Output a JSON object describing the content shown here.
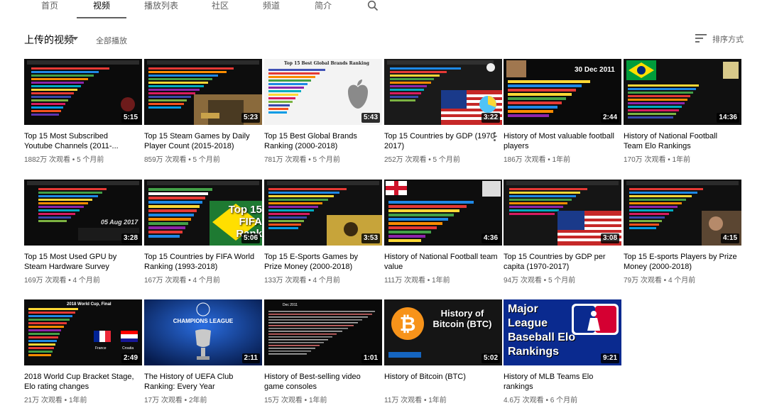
{
  "tabs": {
    "home": "首页",
    "videos": "视频",
    "playlists": "播放列表",
    "community": "社区",
    "channels": "频道",
    "about": "简介"
  },
  "section": {
    "title": "上传的视频",
    "play_all": "全部播放",
    "sort_label": "排序方式"
  },
  "videos": [
    {
      "title": "Top 15 Most Subscribed Youtube Channels (2011-...",
      "views": "1882万 次观看",
      "age": "5 个月前",
      "duration": "5:15"
    },
    {
      "title": "Top 15 Steam Games by Daily Player Count (2015-2018)",
      "views": "859万 次观看",
      "age": "5 个月前",
      "duration": "5:23"
    },
    {
      "title": "Top 15 Best Global Brands Ranking (2000-2018)",
      "views": "781万 次观看",
      "age": "5 个月前",
      "duration": "5:43"
    },
    {
      "title": "Top 15 Countries by GDP (1970-2017)",
      "views": "252万 次观看",
      "age": "5 个月前",
      "duration": "3:22"
    },
    {
      "title": "History of Most valuable football players",
      "views": "186万 次观看",
      "age": "1年前",
      "duration": "2:44"
    },
    {
      "title": "History of National Football Team Elo Rankings",
      "views": "170万 次观看",
      "age": "1年前",
      "duration": "14:36"
    },
    {
      "title": "Top 15 Most Used GPU by Steam Hardware Survey",
      "views": "169万 次观看",
      "age": "4 个月前",
      "duration": "3:28"
    },
    {
      "title": "Top 15 Countries by FIFA World Ranking (1993-2018)",
      "views": "167万 次观看",
      "age": "4 个月前",
      "duration": "5:06"
    },
    {
      "title": "Top 15 E-Sports Games by Prize Money (2000-2018)",
      "views": "133万 次观看",
      "age": "4 个月前",
      "duration": "3:53"
    },
    {
      "title": "History of National Football team value",
      "views": "111万 次观看",
      "age": "1年前",
      "duration": "4:36"
    },
    {
      "title": "Top 15 Countries by GDP per capita (1970-2017)",
      "views": "94万 次观看",
      "age": "5 个月前",
      "duration": "3:08"
    },
    {
      "title": "Top 15 E-sports Players by Prize Money (2000-2018)",
      "views": "79万 次观看",
      "age": "4 个月前",
      "duration": "4:15"
    },
    {
      "title": "2018 World Cup Bracket Stage, Elo rating changes",
      "views": "21万 次观看",
      "age": "1年前",
      "duration": "2:49"
    },
    {
      "title": "The History of UEFA Club Ranking: Every Year",
      "views": "17万 次观看",
      "age": "2年前",
      "duration": "2:11"
    },
    {
      "title": "History of Best-selling video game consoles",
      "views": "15万 次观看",
      "age": "1年前",
      "duration": "1:01"
    },
    {
      "title": "History of Bitcoin (BTC)",
      "views": "11万 次观看",
      "age": "1年前",
      "duration": "5:02"
    },
    {
      "title": "History of MLB Teams Elo rankings",
      "views": "4.6万 次观看",
      "age": "6 个月前",
      "duration": "9:21"
    }
  ],
  "thumb_text": {
    "v5_date": "30 Dec 2011",
    "v7_date": "05 Aug 2017",
    "v8_text": "Top 15 FIFA Rank",
    "v13_final": "2018 World Cup, Final",
    "v13_france": "France",
    "v13_croatia": "Croatia",
    "v14_logo": "CHAMPIONS LEAGUE",
    "v15_date": "Dec 2011",
    "v16_text": "History of Bitcoin (BTC)",
    "v17_text": "Major League Baseball Elo Rankings",
    "v3_header": "Top 15 Best Global Brands Ranking"
  },
  "meta_separator": " • ",
  "colors": {
    "tab_active": "#030303",
    "muted_text": "#606060",
    "bitcoin_orange": "#f7931a",
    "mlb_blue": "#0a2a8f"
  }
}
